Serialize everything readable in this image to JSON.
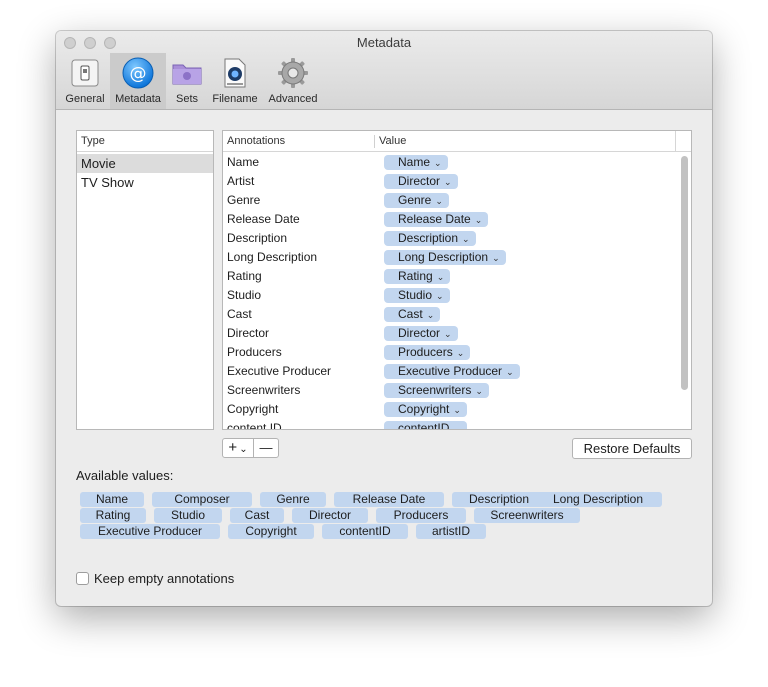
{
  "window": {
    "title": "Metadata"
  },
  "toolbar": {
    "items": [
      {
        "label": "General",
        "icon": "switch-icon"
      },
      {
        "label": "Metadata",
        "icon": "at-sign-icon"
      },
      {
        "label": "Sets",
        "icon": "folder-icon"
      },
      {
        "label": "Filename",
        "icon": "quicktime-file-icon"
      },
      {
        "label": "Advanced",
        "icon": "gear-icon"
      }
    ],
    "selected": "Metadata"
  },
  "type_list": {
    "header": "Type",
    "items": [
      "Movie",
      "TV Show"
    ],
    "selected": "Movie"
  },
  "annotations": {
    "header_name": "Annotations",
    "header_value": "Value",
    "rows": [
      {
        "name": "Name",
        "value": "Name"
      },
      {
        "name": "Artist",
        "value": "Director"
      },
      {
        "name": "Genre",
        "value": "Genre"
      },
      {
        "name": "Release Date",
        "value": "Release Date"
      },
      {
        "name": "Description",
        "value": "Description"
      },
      {
        "name": "Long Description",
        "value": "Long Description"
      },
      {
        "name": "Rating",
        "value": "Rating"
      },
      {
        "name": "Studio",
        "value": "Studio"
      },
      {
        "name": "Cast",
        "value": "Cast"
      },
      {
        "name": "Director",
        "value": "Director"
      },
      {
        "name": "Producers",
        "value": "Producers"
      },
      {
        "name": "Executive Producer",
        "value": "Executive Producer"
      },
      {
        "name": "Screenwriters",
        "value": "Screenwriters"
      },
      {
        "name": "Copyright",
        "value": "Copyright"
      },
      {
        "name": "content ID",
        "value": "contentID"
      }
    ]
  },
  "controls": {
    "add_label": "+",
    "add_menu_chevron": "⌄",
    "remove_label": "—",
    "restore_label": "Restore Defaults"
  },
  "available": {
    "label": "Available values:",
    "rows": [
      [
        "Name",
        "Composer",
        "Genre",
        "Release Date",
        "Description",
        "Long Description"
      ],
      [
        "Rating",
        "Studio",
        "Cast",
        "Director",
        "Producers",
        "Screenwriters"
      ],
      [
        "Executive Producer",
        "Copyright",
        "contentID",
        "artistID"
      ]
    ]
  },
  "options": {
    "keep_empty_label": "Keep empty annotations",
    "keep_empty_checked": false
  },
  "colors": {
    "token": "#c2d6ef",
    "selection": "#dcdcdc",
    "toolbar_selected": "#cbcbcb"
  }
}
